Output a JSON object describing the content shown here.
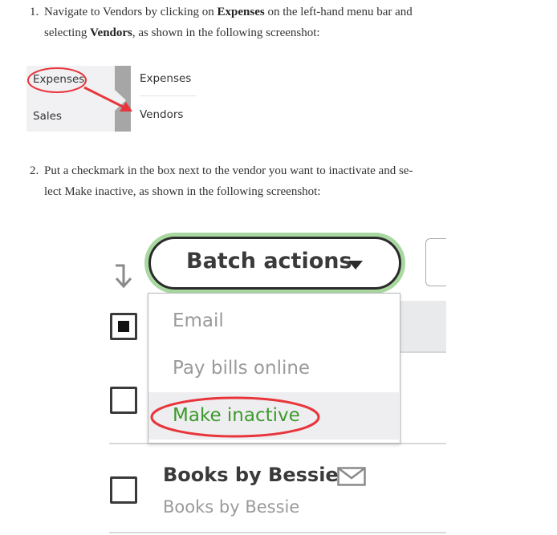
{
  "step1": {
    "number": "1.",
    "line1_a": "Navigate to Vendors by clicking on ",
    "line1_bold": "Expenses",
    "line1_b": " on the left-hand menu bar and",
    "line2_a": "selecting ",
    "line2_bold": "Vendors",
    "line2_b": ", as shown in the following screenshot:"
  },
  "figure1": {
    "left_menu": [
      "Expenses",
      "Sales"
    ],
    "sub_menu": [
      "Expenses",
      "Vendors"
    ],
    "annotation_color": "#e8353b"
  },
  "step2": {
    "number": "2.",
    "line1": "Put a checkmark in the box next to the vendor you want to inactivate and se-",
    "line2": "lect Make inactive, as shown in the following screenshot:"
  },
  "figure2": {
    "batch_button_label": "Batch actions",
    "caret_icon": "caret-down-icon",
    "sort_icon": "sort-arrow-icon",
    "dropdown_items": [
      "Email",
      "Pay bills online",
      "Make inactive"
    ],
    "selected_item": "Make inactive",
    "accent_green": "#3c9a2c",
    "highlight_ring": "#a8d8a0",
    "annotation_color": "#e8353b",
    "vendor": {
      "name": "Books by Bessie",
      "subtitle": "Books by Bessie",
      "icon": "mail-icon"
    },
    "header_checkbox_state": "indeterminate",
    "row_checkboxes": [
      false,
      false
    ]
  }
}
